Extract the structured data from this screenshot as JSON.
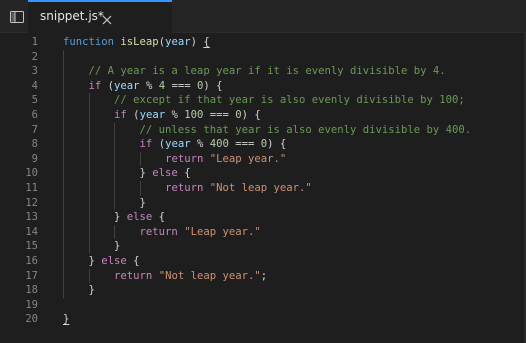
{
  "colors": {
    "background": "#1e1e1e",
    "tab_accent": "#3794ff",
    "line_number": "#858585",
    "keyword": "#569cd6",
    "control": "#c586c0",
    "function": "#dcdcaa",
    "parameter": "#9cdcfe",
    "comment": "#6a9955",
    "number": "#b5cea8",
    "string": "#ce9178"
  },
  "icons": {
    "sidebar_toggle": "sidebar-toggle-icon",
    "tab_close": "close-icon"
  },
  "tab": {
    "label": "snippet.js*"
  },
  "line_numbers": [
    "1",
    "2",
    "3",
    "4",
    "5",
    "6",
    "7",
    "8",
    "9",
    "10",
    "11",
    "12",
    "13",
    "14",
    "15",
    "16",
    "17",
    "18",
    "19",
    "20"
  ],
  "code_lines": [
    [
      {
        "t": "function",
        "c": "keyword"
      },
      {
        "t": " ",
        "c": "plain"
      },
      {
        "t": "isLeap",
        "c": "function"
      },
      {
        "t": "(",
        "c": "plain"
      },
      {
        "t": "year",
        "c": "param"
      },
      {
        "t": ") ",
        "c": "plain"
      },
      {
        "t": "{",
        "c": "brace-u"
      }
    ],
    [],
    [
      {
        "t": "    // A year is a leap year if it is evenly divisible by 4.",
        "c": "comment"
      }
    ],
    [
      {
        "t": "    ",
        "c": "plain"
      },
      {
        "t": "if",
        "c": "control"
      },
      {
        "t": " (",
        "c": "plain"
      },
      {
        "t": "year",
        "c": "param"
      },
      {
        "t": " % ",
        "c": "plain"
      },
      {
        "t": "4",
        "c": "number"
      },
      {
        "t": " === ",
        "c": "plain"
      },
      {
        "t": "0",
        "c": "number"
      },
      {
        "t": ") {",
        "c": "plain"
      }
    ],
    [
      {
        "t": "        // except if that year is also evenly divisible by 100;",
        "c": "comment"
      }
    ],
    [
      {
        "t": "        ",
        "c": "plain"
      },
      {
        "t": "if",
        "c": "control"
      },
      {
        "t": " (",
        "c": "plain"
      },
      {
        "t": "year",
        "c": "param"
      },
      {
        "t": " % ",
        "c": "plain"
      },
      {
        "t": "100",
        "c": "number"
      },
      {
        "t": " === ",
        "c": "plain"
      },
      {
        "t": "0",
        "c": "number"
      },
      {
        "t": ") {",
        "c": "plain"
      }
    ],
    [
      {
        "t": "            // unless that year is also evenly divisible by 400.",
        "c": "comment"
      }
    ],
    [
      {
        "t": "            ",
        "c": "plain"
      },
      {
        "t": "if",
        "c": "control"
      },
      {
        "t": " (",
        "c": "plain"
      },
      {
        "t": "year",
        "c": "param"
      },
      {
        "t": " % ",
        "c": "plain"
      },
      {
        "t": "400",
        "c": "number"
      },
      {
        "t": " === ",
        "c": "plain"
      },
      {
        "t": "0",
        "c": "number"
      },
      {
        "t": ") {",
        "c": "plain"
      }
    ],
    [
      {
        "t": "                ",
        "c": "plain"
      },
      {
        "t": "return",
        "c": "control"
      },
      {
        "t": " ",
        "c": "plain"
      },
      {
        "t": "\"Leap year.\"",
        "c": "string"
      }
    ],
    [
      {
        "t": "            } ",
        "c": "plain"
      },
      {
        "t": "else",
        "c": "control"
      },
      {
        "t": " {",
        "c": "plain"
      }
    ],
    [
      {
        "t": "                ",
        "c": "plain"
      },
      {
        "t": "return",
        "c": "control"
      },
      {
        "t": " ",
        "c": "plain"
      },
      {
        "t": "\"Not leap year.\"",
        "c": "string"
      }
    ],
    [
      {
        "t": "            }",
        "c": "plain"
      }
    ],
    [
      {
        "t": "        } ",
        "c": "plain"
      },
      {
        "t": "else",
        "c": "control"
      },
      {
        "t": " {",
        "c": "plain"
      }
    ],
    [
      {
        "t": "            ",
        "c": "plain"
      },
      {
        "t": "return",
        "c": "control"
      },
      {
        "t": " ",
        "c": "plain"
      },
      {
        "t": "\"Leap year.\"",
        "c": "string"
      }
    ],
    [
      {
        "t": "        }",
        "c": "plain"
      }
    ],
    [
      {
        "t": "    } ",
        "c": "plain"
      },
      {
        "t": "else",
        "c": "control"
      },
      {
        "t": " {",
        "c": "plain"
      }
    ],
    [
      {
        "t": "        ",
        "c": "plain"
      },
      {
        "t": "return",
        "c": "control"
      },
      {
        "t": " ",
        "c": "plain"
      },
      {
        "t": "\"Not leap year.\"",
        "c": "string"
      },
      {
        "t": ";",
        "c": "plain"
      }
    ],
    [
      {
        "t": "    }",
        "c": "plain"
      }
    ],
    [],
    [
      {
        "t": "}",
        "c": "brace-u"
      }
    ]
  ]
}
